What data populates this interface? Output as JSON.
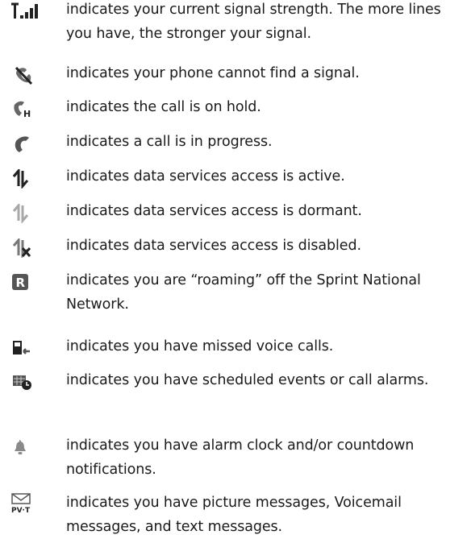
{
  "items": [
    {
      "icon": "signal-strength-icon",
      "text": "indicates your current signal strength. The more lines you have, the stronger your signal."
    },
    {
      "icon": "no-signal-icon",
      "text": "indicates your phone cannot find a signal."
    },
    {
      "icon": "call-on-hold-icon",
      "text": "indicates the call is on hold."
    },
    {
      "icon": "call-in-progress-icon",
      "text": "indicates a call is in progress."
    },
    {
      "icon": "data-active-icon",
      "text": "indicates data services access is active."
    },
    {
      "icon": "data-dormant-icon",
      "text": "indicates data services access is dormant."
    },
    {
      "icon": "data-disabled-icon",
      "text": "indicates data services access is disabled."
    },
    {
      "icon": "roaming-icon",
      "text": "indicates you are “roaming” off the Sprint National Network."
    },
    {
      "icon": "missed-call-icon",
      "text": "indicates you have missed voice calls."
    },
    {
      "icon": "scheduled-event-icon",
      "text": "indicates you have scheduled events or call alarms."
    },
    {
      "icon": "alarm-bell-icon",
      "text": "indicates you have alarm clock and/or countdown notifications."
    },
    {
      "icon": "messages-icon",
      "text": "indicates you have picture messages, Voicemail messages, and text messages."
    }
  ],
  "icon_labels": {
    "hold_letter": "H",
    "roaming_letter": "R",
    "messages_letters": "PV·T"
  }
}
